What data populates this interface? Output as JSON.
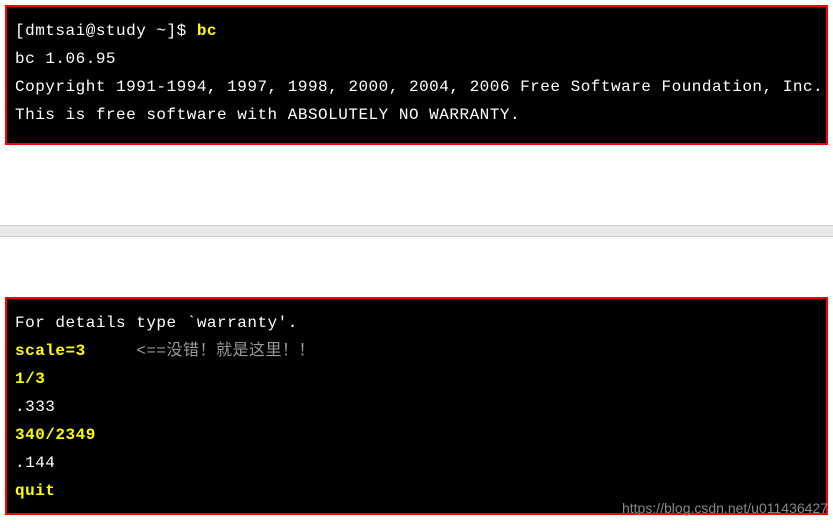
{
  "terminal1": {
    "prompt": "[dmtsai@study ~]$ ",
    "command": "bc",
    "line1": "bc 1.06.95",
    "line2": "Copyright 1991-1994, 1997, 1998, 2000, 2004, 2006 Free Software Foundation, Inc.",
    "line3": "This is free software with ABSOLUTELY NO WARRANTY."
  },
  "terminal2": {
    "line1": "For details type `warranty'.",
    "input1": "scale=3",
    "annotation1": "     <==没错！就是这里！！",
    "input2": "1/3",
    "output2": ".333",
    "input3": "340/2349",
    "output3": ".144",
    "input4": "quit"
  },
  "watermark": "https://blog.csdn.net/u011436427"
}
